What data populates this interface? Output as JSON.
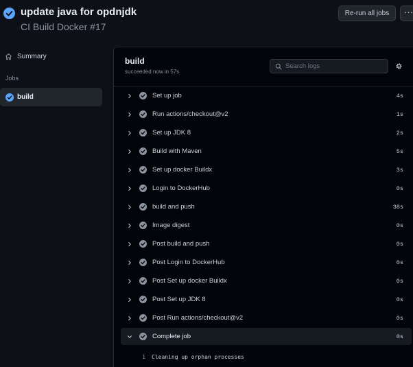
{
  "header": {
    "title": "update java for opdnjdk",
    "subtitle": "CI Build Docker #17",
    "rerun_label": "Re-run all jobs",
    "more_label": "···",
    "status_color": "#58a6ff"
  },
  "sidebar": {
    "summary_label": "Summary",
    "jobs_heading": "Jobs",
    "jobs": [
      {
        "label": "build",
        "status": "success",
        "selected": true
      }
    ]
  },
  "panel": {
    "title": "build",
    "subtitle": "succeeded now in 57s",
    "search_placeholder": "Search logs",
    "steps": [
      {
        "name": "Set up job",
        "duration": "4s",
        "expanded": false
      },
      {
        "name": "Run actions/checkout@v2",
        "duration": "1s",
        "expanded": false
      },
      {
        "name": "Set up JDK 8",
        "duration": "2s",
        "expanded": false
      },
      {
        "name": "Build with Maven",
        "duration": "5s",
        "expanded": false
      },
      {
        "name": "Set up docker Buildx",
        "duration": "3s",
        "expanded": false
      },
      {
        "name": "Login to DockerHub",
        "duration": "0s",
        "expanded": false
      },
      {
        "name": "build and push",
        "duration": "38s",
        "expanded": false
      },
      {
        "name": "Image digest",
        "duration": "0s",
        "expanded": false
      },
      {
        "name": "Post build and push",
        "duration": "0s",
        "expanded": false
      },
      {
        "name": "Post Login to DockerHub",
        "duration": "0s",
        "expanded": false
      },
      {
        "name": "Post Set up docker Buildx",
        "duration": "0s",
        "expanded": false
      },
      {
        "name": "Post Set up JDK 8",
        "duration": "0s",
        "expanded": false
      },
      {
        "name": "Post Run actions/checkout@v2",
        "duration": "0s",
        "expanded": false
      },
      {
        "name": "Complete job",
        "duration": "0s",
        "expanded": true
      }
    ],
    "log_lines": [
      {
        "number": "1",
        "text": "Cleaning up orphan processes"
      }
    ]
  },
  "icons": {
    "status": "check-circle-icon",
    "summary": "home-icon",
    "search": "search-icon",
    "settings": "gear-icon",
    "collapsed": "chevron-right-icon",
    "expanded": "chevron-down-icon"
  },
  "colors": {
    "background": "#0d1117",
    "panel": "#010409",
    "accent": "#58a6ff",
    "step_check": "#8b949e"
  }
}
